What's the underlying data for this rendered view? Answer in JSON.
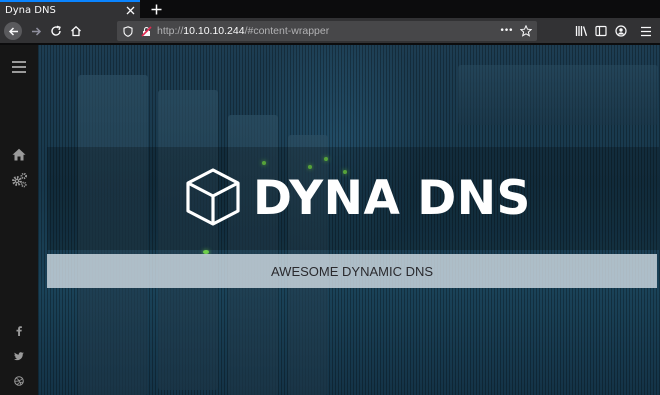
{
  "browser": {
    "tab_title": "Dyna DNS",
    "url_protocol": "http://",
    "url_host": "10.10.10.244",
    "url_path": "/#content-wrapper",
    "more_label": "•••"
  },
  "sidebar": {
    "items": [
      {
        "icon": "hamburger-menu-icon"
      },
      {
        "icon": "home-icon"
      },
      {
        "icon": "cogs-icon"
      },
      {
        "icon": "facebook-icon"
      },
      {
        "icon": "twitter-icon"
      },
      {
        "icon": "dribbble-icon"
      }
    ]
  },
  "hero": {
    "brand": "DYNA DNS",
    "tagline": "AWESOME DYNAMIC DNS",
    "logo_icon": "cube-icon"
  },
  "colors": {
    "accent": "#0a84ff",
    "toolbar": "#323234",
    "sidebar": "#161616",
    "hero_bg": "#1a4258",
    "tagline_bar": "#d7e2e9"
  }
}
